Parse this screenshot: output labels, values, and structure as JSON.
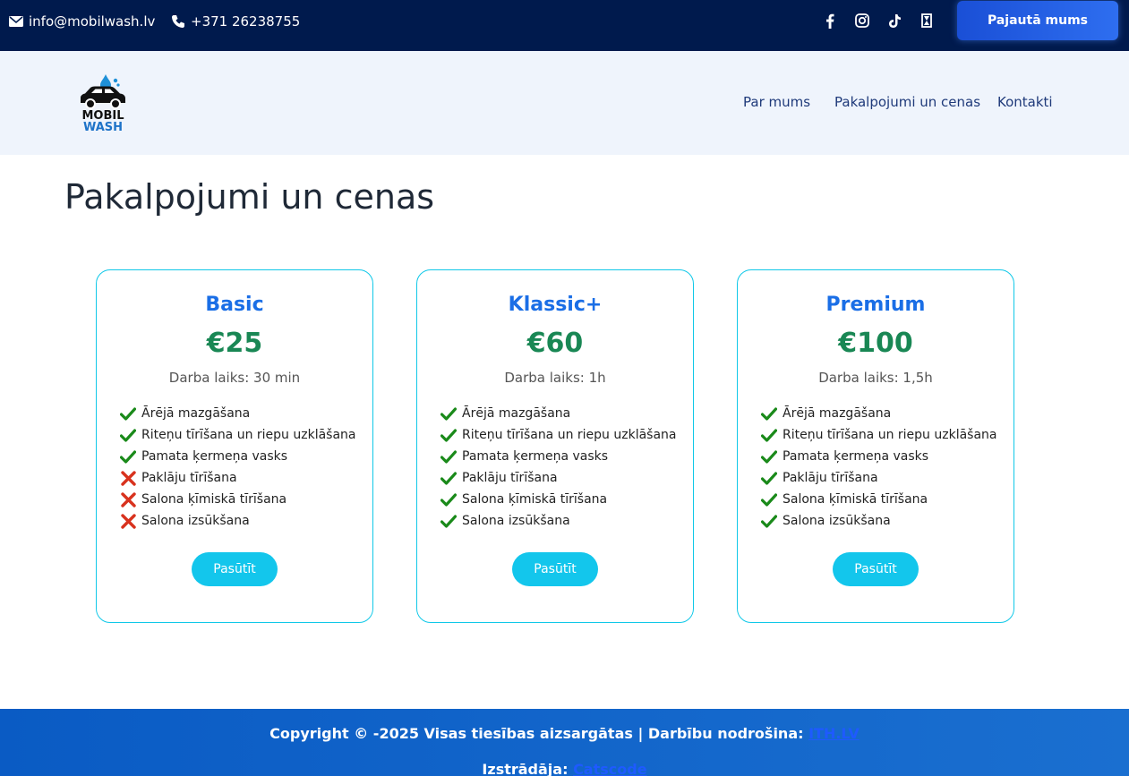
{
  "topbar": {
    "email": "info@mobilwash.lv",
    "phone": "+371 26238755",
    "social": [
      "facebook-icon",
      "instagram-icon",
      "tiktok-icon",
      "waze-icon"
    ],
    "cta_label": "Pajautā mums"
  },
  "header": {
    "logo_line1": "MOBIL",
    "logo_line2": "WASH",
    "nav": [
      "Par mums",
      "Pakalpojumi un cenas",
      "Kontakti"
    ]
  },
  "page_title": "Pakalpojumi un cenas",
  "plans": [
    {
      "name": "Basic",
      "price": "€25",
      "time": "Darba laiks: 30 min",
      "features": [
        {
          "label": "Ārējā mazgāšana",
          "included": true
        },
        {
          "label": "Riteņu tīrīšana un riepu uzklāšana",
          "included": true
        },
        {
          "label": "Pamata ķermeņa vasks",
          "included": true
        },
        {
          "label": "Paklāju tīrīšana",
          "included": false
        },
        {
          "label": "Salona ķīmiskā tīrīšana",
          "included": false
        },
        {
          "label": "Salona izsūkšana",
          "included": false
        }
      ],
      "button": "Pasūtīt"
    },
    {
      "name": "Klassic+",
      "price": "€60",
      "time": "Darba laiks: 1h",
      "features": [
        {
          "label": "Ārējā mazgāšana",
          "included": true
        },
        {
          "label": "Riteņu tīrīšana un riepu uzklāšana",
          "included": true
        },
        {
          "label": "Pamata ķermeņa vasks",
          "included": true
        },
        {
          "label": "Paklāju tīrīšana",
          "included": true
        },
        {
          "label": "Salona ķīmiskā tīrīšana",
          "included": true
        },
        {
          "label": "Salona izsūkšana",
          "included": true
        }
      ],
      "button": "Pasūtīt"
    },
    {
      "name": "Premium",
      "price": "€100",
      "time": "Darba laiks: 1,5h",
      "features": [
        {
          "label": "Ārējā mazgāšana",
          "included": true
        },
        {
          "label": "Riteņu tīrīšana un riepu uzklāšana",
          "included": true
        },
        {
          "label": "Pamata ķermeņa vasks",
          "included": true
        },
        {
          "label": "Paklāju tīrīšana",
          "included": true
        },
        {
          "label": "Salona ķīmiskā tīrīšana",
          "included": true
        },
        {
          "label": "Salona izsūkšana",
          "included": true
        }
      ],
      "button": "Pasūtīt"
    }
  ],
  "footer": {
    "copyright_text": "Copyright © -2025 Visas tiesības aizsargātas | Darbību nodrošina:",
    "provider_link": "ITH.LV",
    "developer_text": "Izstrādāja:",
    "developer_link": "Catscode"
  },
  "colors": {
    "topbar_bg": "#001a4d",
    "accent_blue": "#1a6ee6",
    "price_green": "#198754",
    "button_cyan": "#13c6ec",
    "check_green": "#1a8a1a",
    "cross_red": "#d8321e"
  }
}
